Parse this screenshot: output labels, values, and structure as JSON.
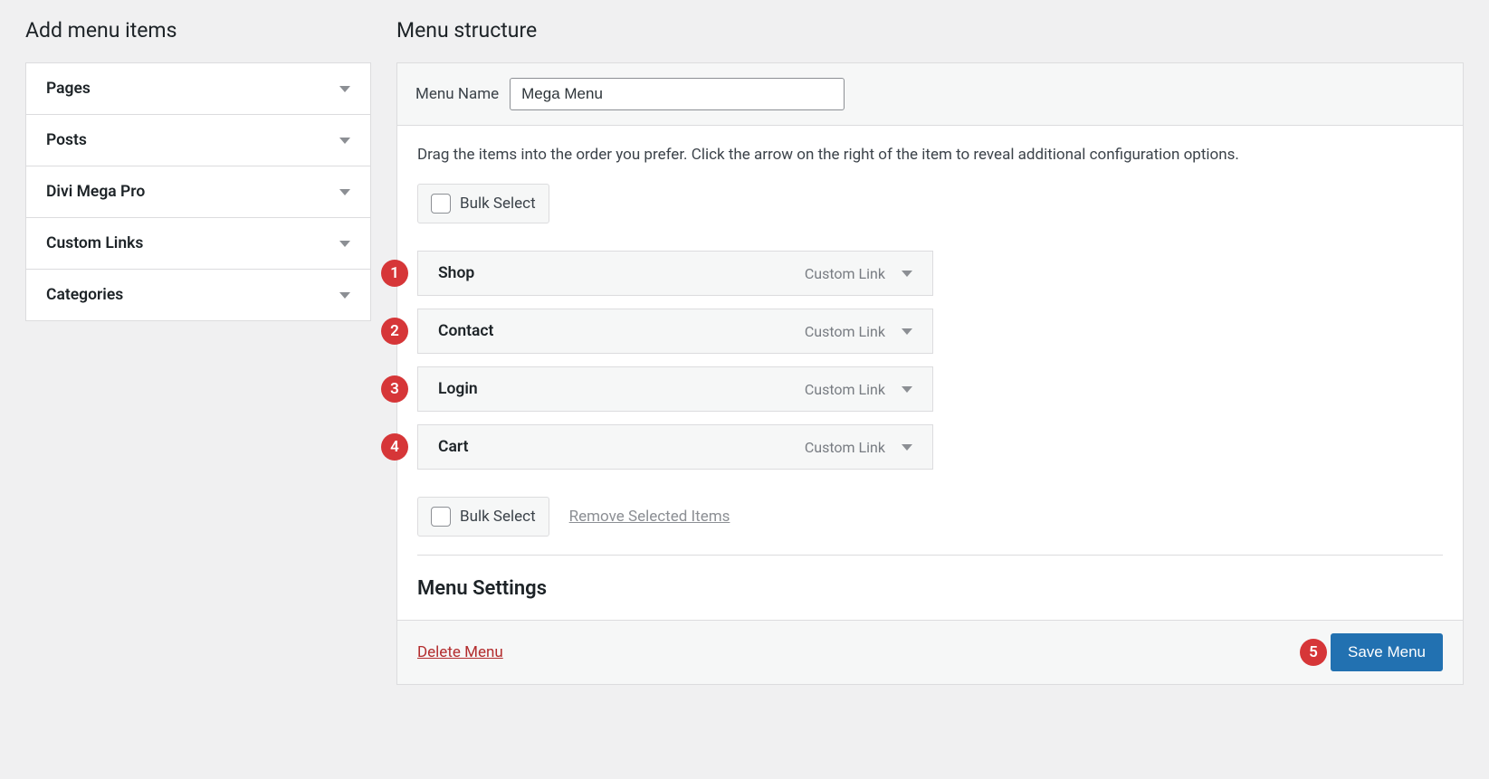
{
  "sidebar": {
    "heading": "Add menu items",
    "items": [
      {
        "label": "Pages"
      },
      {
        "label": "Posts"
      },
      {
        "label": "Divi Mega Pro"
      },
      {
        "label": "Custom Links"
      },
      {
        "label": "Categories"
      }
    ]
  },
  "main": {
    "heading": "Menu structure",
    "menu_name_label": "Menu Name",
    "menu_name_value": "Mega Menu",
    "instructions": "Drag the items into the order you prefer. Click the arrow on the right of the item to reveal additional configuration options.",
    "bulk_select_label": "Bulk Select",
    "items": [
      {
        "badge": "1",
        "title": "Shop",
        "type": "Custom Link"
      },
      {
        "badge": "2",
        "title": "Contact",
        "type": "Custom Link"
      },
      {
        "badge": "3",
        "title": "Login",
        "type": "Custom Link"
      },
      {
        "badge": "4",
        "title": "Cart",
        "type": "Custom Link"
      }
    ],
    "remove_selected_label": "Remove Selected Items",
    "menu_settings_heading": "Menu Settings",
    "footer": {
      "delete_label": "Delete Menu",
      "save_label": "Save Menu",
      "save_badge": "5"
    }
  }
}
